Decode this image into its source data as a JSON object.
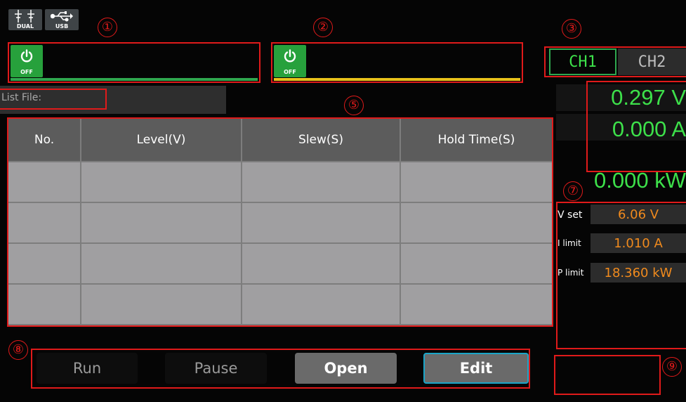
{
  "status_icons": {
    "dual_label": "DUAL",
    "dual_icon": "dual-channel-icon",
    "usb_label": "USB",
    "usb_icon": "usb-icon"
  },
  "callouts": [
    "①",
    "②",
    "③",
    "④",
    "⑤",
    "⑥",
    "⑦",
    "⑧",
    "⑨"
  ],
  "channels": {
    "ch1": {
      "power_state": "OFF",
      "indicator_color": "#2fa84f"
    },
    "ch2": {
      "power_state": "OFF",
      "indicator_color": "#e8c21a"
    }
  },
  "channel_tabs": [
    {
      "label": "CH1",
      "selected": true
    },
    {
      "label": "CH2",
      "selected": false
    }
  ],
  "list_file": {
    "label": "List File:",
    "value": ""
  },
  "table": {
    "headers": [
      "No.",
      "Level(V)",
      "Slew(S)",
      "Hold Time(S)"
    ],
    "rows": [
      [
        "",
        "",
        "",
        ""
      ],
      [
        "",
        "",
        "",
        ""
      ],
      [
        "",
        "",
        "",
        ""
      ],
      [
        "",
        "",
        "",
        ""
      ]
    ]
  },
  "measurements": {
    "voltage": "0.297 V",
    "current": "0.000 A",
    "power": "0.000 kW"
  },
  "settings": {
    "v_set_label": "V set",
    "v_set_value": "6.06 V",
    "i_limit_label": "I limit",
    "i_limit_value": "1.010 A",
    "p_limit_label": "P limit",
    "p_limit_value": "18.360 kW"
  },
  "buttons": {
    "run": "Run",
    "pause": "Pause",
    "open": "Open",
    "edit": "Edit"
  },
  "colors": {
    "accent_green": "#3de04a",
    "setting_orange": "#f08a1d",
    "annotation_red": "#e01a1a",
    "ch2_indicator": "#e8c21a"
  }
}
